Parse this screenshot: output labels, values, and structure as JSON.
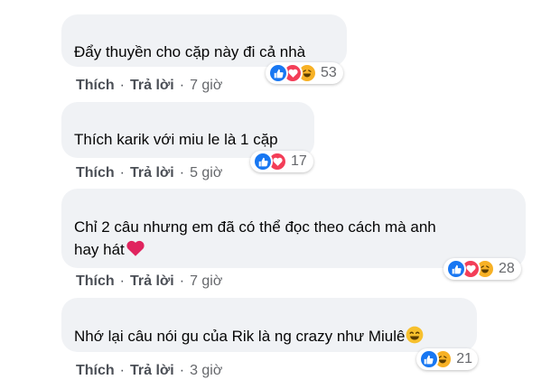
{
  "comments": [
    {
      "text": "Đẩy thuyền cho cặp này đi cả nhà",
      "like": "Thích",
      "reply": "Trả lời",
      "time": "7 giờ",
      "reaction_count": "53",
      "reactions": [
        "like",
        "love",
        "haha"
      ]
    },
    {
      "text": "Thích karik với miu le là 1 cặp",
      "like": "Thích",
      "reply": "Trả lời",
      "time": "5 giờ",
      "reaction_count": "17",
      "reactions": [
        "like",
        "love"
      ]
    },
    {
      "text_line1": "Chỉ 2 câu nhưng em đã có thể đọc theo cách mà anh",
      "text_line2": "hay hát",
      "like": "Thích",
      "reply": "Trả lời",
      "time": "7 giờ",
      "reaction_count": "28",
      "reactions": [
        "like",
        "love",
        "haha"
      ],
      "trailing_emoji": "red-heart-emoji"
    },
    {
      "text": "Nhớ lại câu nói gu của Rik là ng crazy như Miulê",
      "like": "Thích",
      "reply": "Trả lời",
      "time": "3 giờ",
      "reaction_count": "21",
      "reactions": [
        "like",
        "haha"
      ],
      "trailing_emoji": "smiling-face-emoji"
    }
  ],
  "separator": "·",
  "colors": {
    "bubble": "#f0f2f5",
    "like": "#1877f2",
    "love": "#f33e58",
    "haha": "#f7b125",
    "action_text": "#4b4f56",
    "meta_text": "#65676b"
  }
}
